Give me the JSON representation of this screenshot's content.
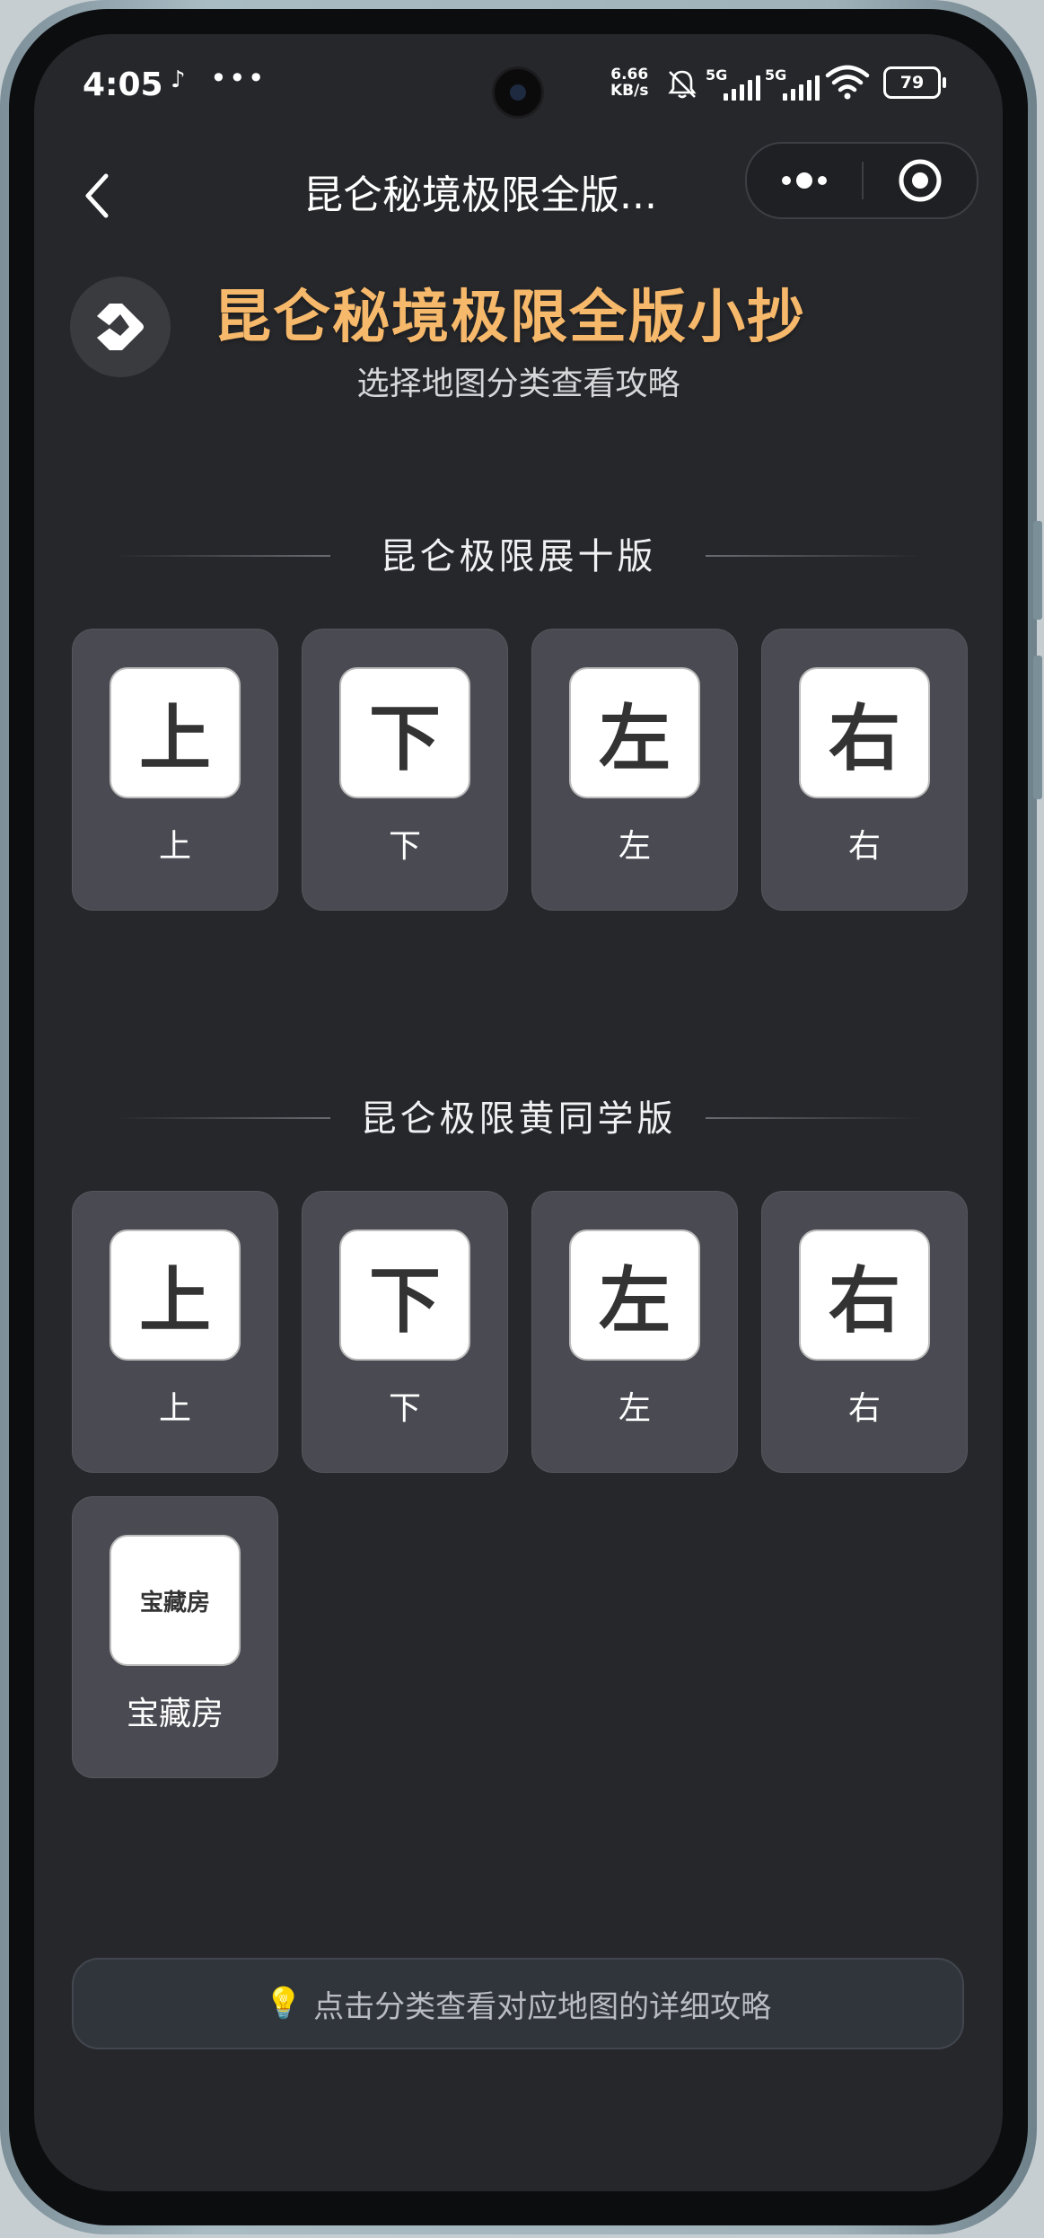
{
  "status_bar": {
    "time": "4:05",
    "more_dots": "•••",
    "speed_value": "6.66",
    "speed_unit": "KB/s",
    "signal1_label": "5G",
    "signal2_label": "5G",
    "battery": "79"
  },
  "nav": {
    "title": "昆仑秘境极限全版..."
  },
  "header": {
    "title": "昆仑秘境极限全版小抄",
    "subtitle": "选择地图分类查看攻略"
  },
  "sections": [
    {
      "title": "昆仑极限展十版",
      "items": [
        {
          "icon_text": "上",
          "label": "上"
        },
        {
          "icon_text": "下",
          "label": "下"
        },
        {
          "icon_text": "左",
          "label": "左"
        },
        {
          "icon_text": "右",
          "label": "右"
        }
      ]
    },
    {
      "title": "昆仑极限黄同学版",
      "items": [
        {
          "icon_text": "上",
          "label": "上"
        },
        {
          "icon_text": "下",
          "label": "下"
        },
        {
          "icon_text": "左",
          "label": "左"
        },
        {
          "icon_text": "右",
          "label": "右"
        },
        {
          "icon_text": "宝藏房",
          "label": "宝藏房"
        }
      ]
    }
  ],
  "hint": {
    "icon": "lightbulb-icon",
    "text": "点击分类查看对应地图的详细攻略"
  },
  "colors": {
    "background": "#26272b",
    "title_accent": "#f6b86a",
    "card": "#4a4a52"
  }
}
